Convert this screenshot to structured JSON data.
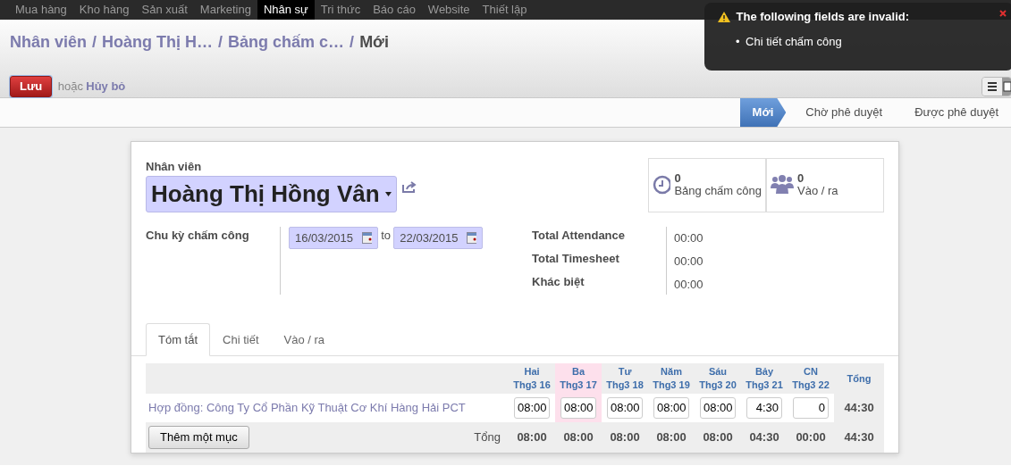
{
  "top_menu": [
    {
      "label": "Mua hàng",
      "selected": false
    },
    {
      "label": "Kho hàng",
      "selected": false
    },
    {
      "label": "Sản xuất",
      "selected": false
    },
    {
      "label": "Marketing",
      "selected": false
    },
    {
      "label": "Nhân sự",
      "selected": true
    },
    {
      "label": "Tri thức",
      "selected": false
    },
    {
      "label": "Báo cáo",
      "selected": false
    },
    {
      "label": "Website",
      "selected": false
    },
    {
      "label": "Thiết lập",
      "selected": false
    }
  ],
  "notification": {
    "title": "The following fields are invalid:",
    "items": [
      {
        "bullet": "•",
        "text": "Chi tiết chấm công"
      }
    ]
  },
  "breadcrumb": [
    {
      "label": "Nhân viên",
      "kind": "link"
    },
    {
      "label": "/",
      "kind": "separator"
    },
    {
      "label": "Hoàng Thị H…",
      "kind": "link"
    },
    {
      "label": "/",
      "kind": "separator"
    },
    {
      "label": "Bảng chấm c…",
      "kind": "link"
    },
    {
      "label": "/",
      "kind": "separator"
    },
    {
      "label": "Mới",
      "kind": "current"
    }
  ],
  "actions": {
    "save": "Lưu",
    "or": "hoặc",
    "cancel": "Hủy bỏ"
  },
  "stages": [
    {
      "label": "Mới",
      "selected": true
    },
    {
      "label": "Chờ phê duyệt",
      "selected": false
    },
    {
      "label": "Được phê duyệt",
      "selected": false
    }
  ],
  "employee": {
    "label": "Nhân viên",
    "value": "Hoàng Thị Hồng Vân"
  },
  "smart_buttons": [
    {
      "kind": "clock",
      "count": "0",
      "label": "Bảng chấm công"
    },
    {
      "kind": "people",
      "count": "0",
      "label": "Vào / ra"
    }
  ],
  "period": {
    "label": "Chu kỳ chấm công",
    "from": "16/03/2015",
    "to_word": "to",
    "to": "22/03/2015"
  },
  "totals": [
    {
      "label": "Total Attendance",
      "value": "00:00"
    },
    {
      "label": "Total Timesheet",
      "value": "00:00"
    },
    {
      "label": "Khác biệt",
      "value": "00:00"
    }
  ],
  "tabs": [
    {
      "label": "Tóm tắt",
      "selected": true
    },
    {
      "label": "Chi tiết",
      "selected": false
    },
    {
      "label": "Vào / ra",
      "selected": false
    }
  ],
  "summary": {
    "total_heading": "Tổng",
    "row_label": "Hợp đồng: Công Ty Cổ Phần Kỹ Thuật Cơ Khí Hàng Hải PCT",
    "row_total": "44:30",
    "add_button": "Thêm một mục",
    "footer_label": "Tổng",
    "footer_total": "44:30",
    "days": [
      {
        "day": "Hai",
        "date": "Thg3 16",
        "value": "08:00",
        "total": "08:00",
        "today": false
      },
      {
        "day": "Ba",
        "date": "Thg3 17",
        "value": "08:00",
        "total": "08:00",
        "today": true
      },
      {
        "day": "Tư",
        "date": "Thg3 18",
        "value": "08:00",
        "total": "08:00",
        "today": false
      },
      {
        "day": "Năm",
        "date": "Thg3 19",
        "value": "08:00",
        "total": "08:00",
        "today": false
      },
      {
        "day": "Sáu",
        "date": "Thg3 20",
        "value": "08:00",
        "total": "08:00",
        "today": false
      },
      {
        "day": "Bảy",
        "date": "Thg3 21",
        "value": "4:30",
        "total": "04:30",
        "today": false
      },
      {
        "day": "CN",
        "date": "Thg3 22",
        "value": "0",
        "total": "00:00",
        "today": false
      }
    ]
  }
}
